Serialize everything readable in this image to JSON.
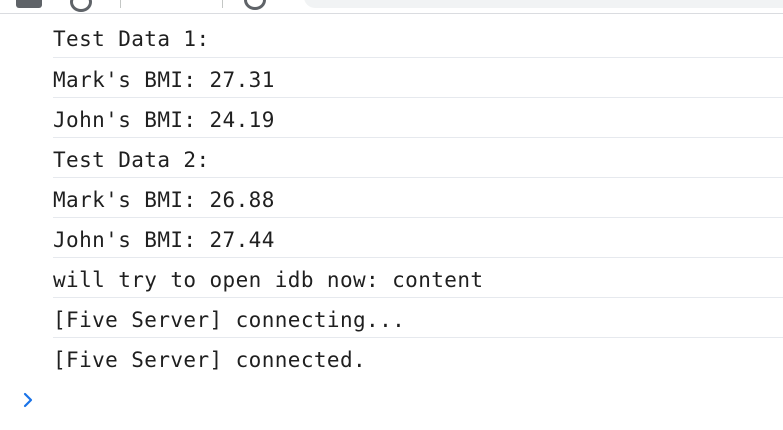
{
  "toolbar": {
    "icons": [
      "menu-icon",
      "clear-console-icon",
      "filter-dropdown",
      "settings-icon",
      "filter-input"
    ]
  },
  "console": {
    "messages": [
      "Test Data 1:",
      "Mark's BMI: 27.31",
      "John's BMI: 24.19",
      "Test Data 2:",
      "Mark's BMI: 26.88",
      "John's BMI: 27.44",
      "will try to open idb now: content",
      "[Five Server] connecting...",
      "[Five Server] connected."
    ]
  },
  "prompt": {
    "icon": "chevron-right-icon",
    "color": "#1a73e8"
  }
}
